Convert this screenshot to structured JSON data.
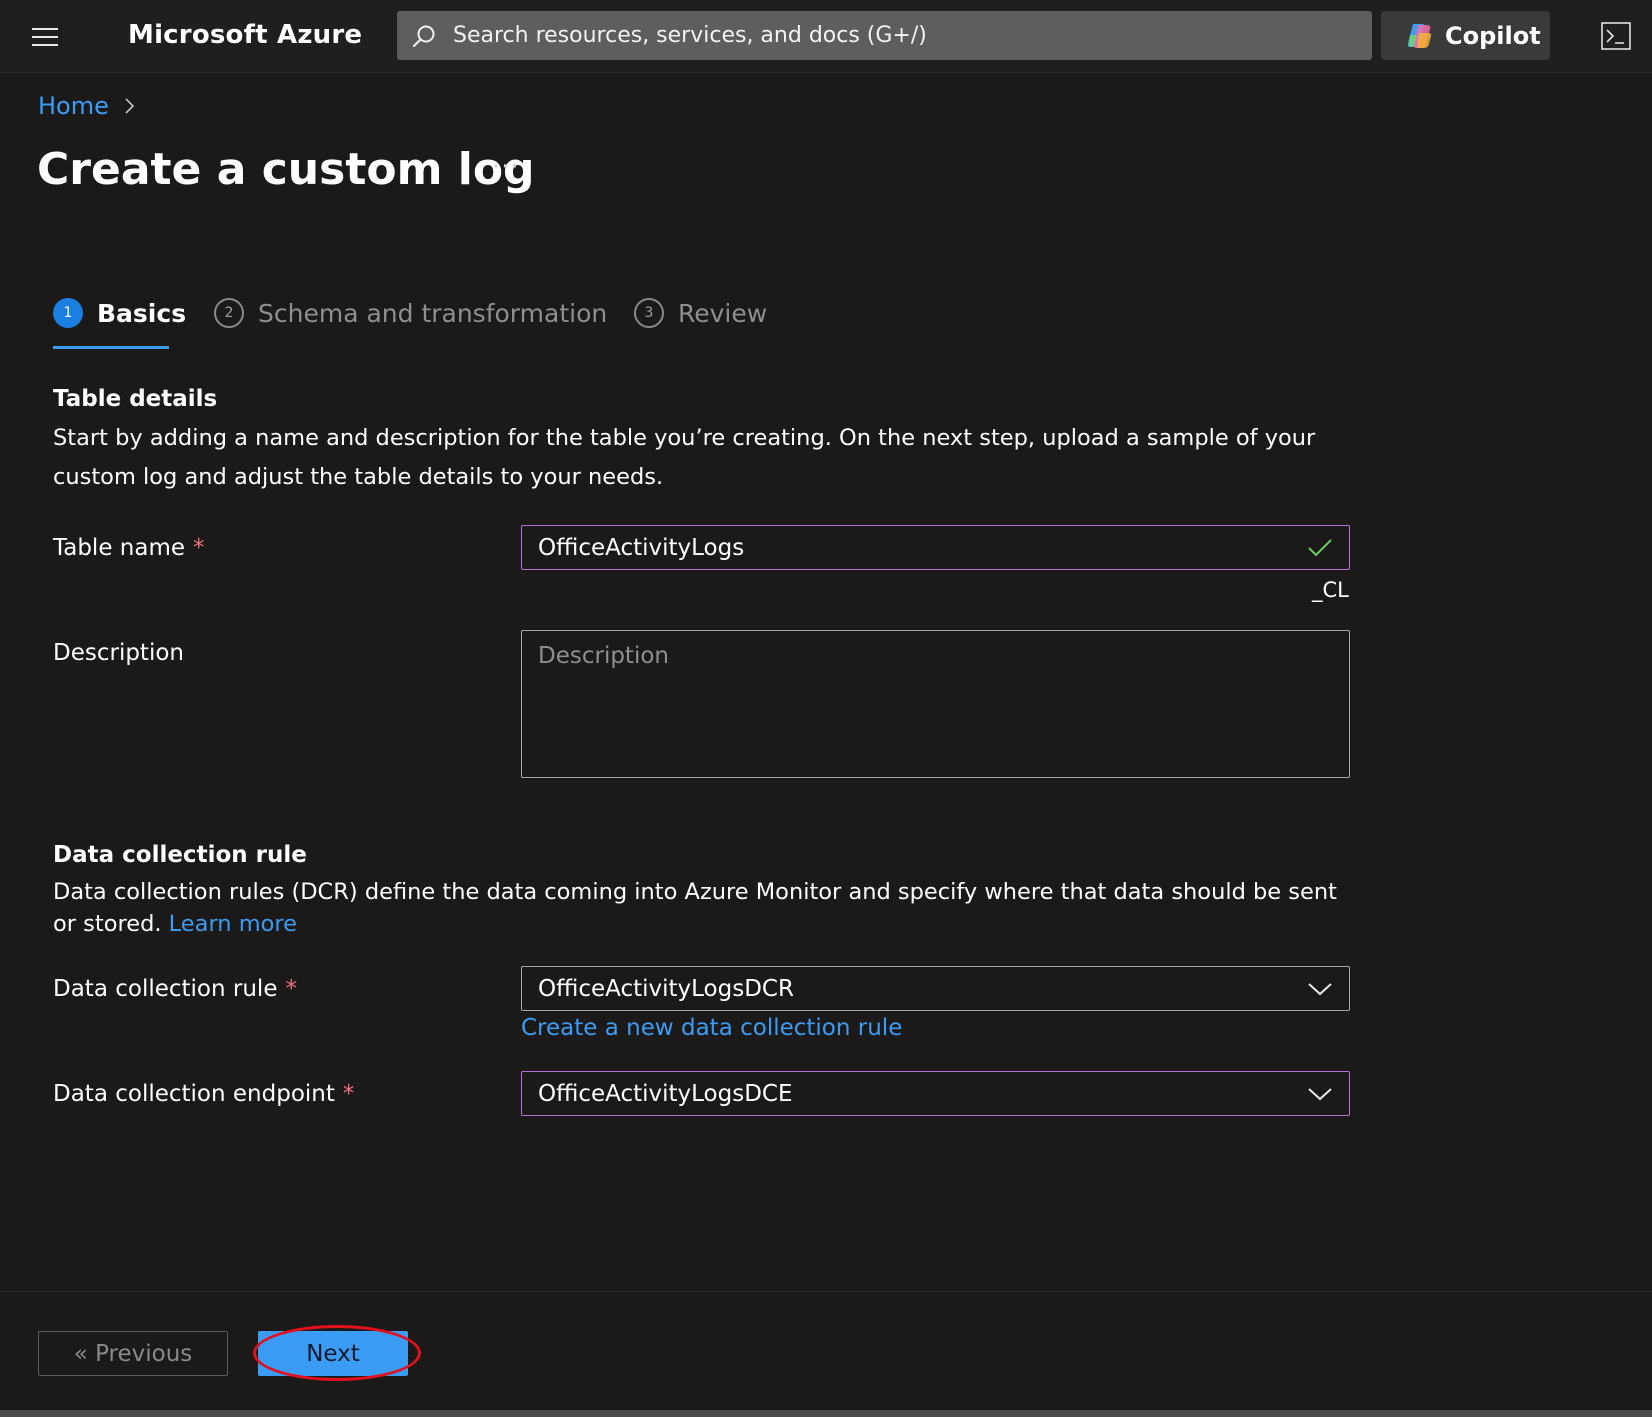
{
  "topbar": {
    "brand": "Microsoft Azure",
    "search_placeholder": "Search resources, services, and docs (G+/)",
    "copilot_label": "Copilot"
  },
  "breadcrumb": {
    "home": "Home"
  },
  "page": {
    "title": "Create a custom log",
    "more": "···"
  },
  "tabs": [
    {
      "num": "1",
      "label": "Basics",
      "active": true
    },
    {
      "num": "2",
      "label": "Schema and transformation",
      "active": false
    },
    {
      "num": "3",
      "label": "Review",
      "active": false
    }
  ],
  "table_details": {
    "title": "Table details",
    "description": "Start by adding a name and description for the table you’re creating. On the next step, upload a sample of your custom log and adjust the table details to your needs.",
    "table_name_label": "Table name",
    "table_name_value": "OfficeActivityLogs",
    "table_name_suffix": "_CL",
    "description_label": "Description",
    "description_placeholder": "Description",
    "required_mark": "*"
  },
  "dcr": {
    "title": "Data collection rule",
    "description": "Data collection rules (DCR) define the data coming into Azure Monitor and specify where that data should be sent or stored.",
    "learn_more": "Learn more",
    "rule_label": "Data collection rule",
    "rule_value": "OfficeActivityLogsDCR",
    "create_link": "Create a new data collection rule",
    "endpoint_label": "Data collection endpoint",
    "endpoint_value": "OfficeActivityLogsDCE"
  },
  "footer": {
    "previous_label": "« Previous",
    "next_label": "Next"
  },
  "colors": {
    "accent": "#3b9cf5",
    "focus_border": "#b96fd8",
    "required": "#f1707b",
    "highlight": "#e3101e",
    "valid_check": "#6ccb5f"
  },
  "icons": [
    "hamburger-menu-icon",
    "search-icon",
    "copilot-logo-icon",
    "cloud-shell-icon",
    "chevron-right-icon",
    "more-options-icon",
    "checkmark-icon",
    "chevron-down-icon"
  ]
}
